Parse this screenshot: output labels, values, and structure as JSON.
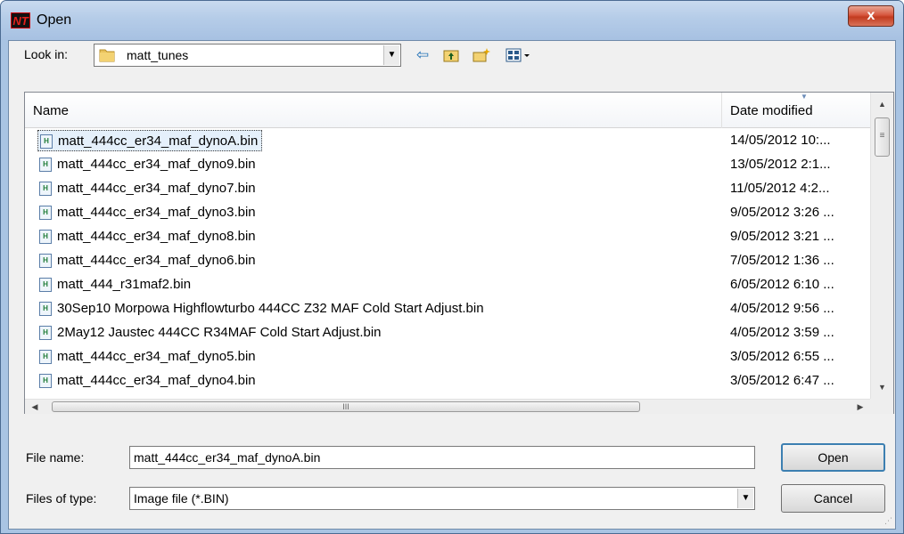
{
  "window": {
    "title": "Open",
    "app_icon_letters": "NT",
    "close_glyph": "x"
  },
  "lookin": {
    "label": "Look in:",
    "value": "matt_tunes",
    "arrow": "▼"
  },
  "toolbar": {
    "back_glyph": "⇦",
    "up_glyph": "⬑",
    "new_folder_glyph": "✱",
    "view_menu_glyph": "▦▾"
  },
  "columns": {
    "name": "Name",
    "date": "Date modified"
  },
  "files": [
    {
      "name": "matt_444cc_er34_maf_dynoA.bin",
      "date": "14/05/2012 10:...",
      "selected": true
    },
    {
      "name": "matt_444cc_er34_maf_dyno9.bin",
      "date": "13/05/2012 2:1..."
    },
    {
      "name": "matt_444cc_er34_maf_dyno7.bin",
      "date": "11/05/2012 4:2..."
    },
    {
      "name": "matt_444cc_er34_maf_dyno3.bin",
      "date": "9/05/2012 3:26 ..."
    },
    {
      "name": "matt_444cc_er34_maf_dyno8.bin",
      "date": "9/05/2012 3:21 ..."
    },
    {
      "name": "matt_444cc_er34_maf_dyno6.bin",
      "date": "7/05/2012 1:36 ..."
    },
    {
      "name": "matt_444_r31maf2.bin",
      "date": "6/05/2012 6:10 ..."
    },
    {
      "name": "30Sep10 Morpowa Highflowturbo 444CC Z32 MAF Cold Start Adjust.bin",
      "date": "4/05/2012 9:56 ..."
    },
    {
      "name": "2May12 Jaustec 444CC R34MAF Cold Start Adjust.bin",
      "date": "4/05/2012 3:59 ..."
    },
    {
      "name": "matt_444cc_er34_maf_dyno5.bin",
      "date": "3/05/2012 6:55 ..."
    },
    {
      "name": "matt_444cc_er34_maf_dyno4.bin",
      "date": "3/05/2012 6:47 ..."
    }
  ],
  "scrollbars": {
    "up": "▲",
    "down": "▼",
    "left": "◀",
    "right": "▶",
    "vthumb_grip": "≡",
    "hthumb_grip": "III"
  },
  "filename": {
    "label": "File name:",
    "value": "matt_444cc_er34_maf_dynoA.bin"
  },
  "filetype": {
    "label": "Files of type:",
    "value": "Image file (*.BIN)",
    "arrow": "▼"
  },
  "buttons": {
    "open": "Open",
    "cancel": "Cancel"
  },
  "colors": {
    "title_bar": "#b5cce8",
    "close_button": "#c23b1f",
    "selection": "#e5f0fb",
    "file_icon_green": "#1e7b36"
  }
}
